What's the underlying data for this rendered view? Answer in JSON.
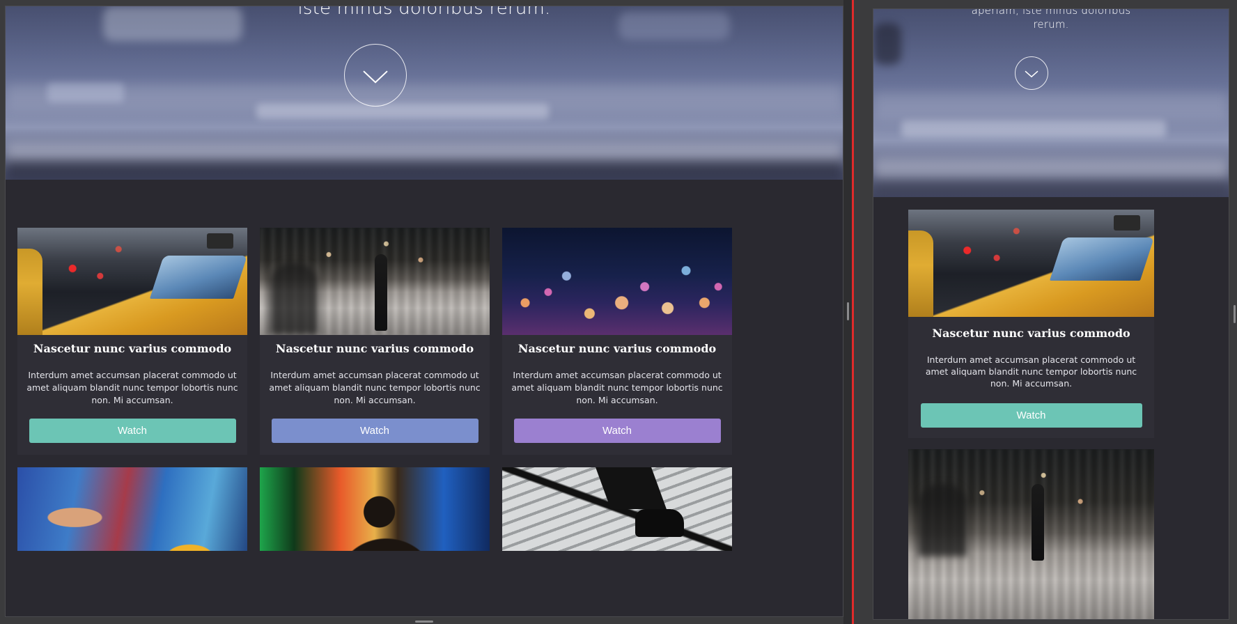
{
  "hero": {
    "left_subtitle": "iste minus doloribus rerum.",
    "right_subtitle_line1": "aperiam, iste minus doloribus",
    "right_subtitle_line2": "rerum."
  },
  "colors": {
    "teal": "#6cc5b5",
    "blue": "#7b8fcd",
    "purple": "#9b80d0",
    "divider": "#e02a2a",
    "card_bg": "#2f2e36",
    "page_bg": "#2a2930"
  },
  "cards": [
    {
      "title": "Nascetur nunc varius commodo",
      "text": "Interdum amet accumsan placerat commodo ut amet aliquam blandit nunc tempor lobortis nunc non. Mi accumsan.",
      "button": "Watch",
      "button_color": "#6cc5b5",
      "image": "taxi-street-photo"
    },
    {
      "title": "Nascetur nunc varius commodo",
      "text": "Interdum amet accumsan placerat commodo ut amet aliquam blandit nunc tempor lobortis nunc non. Mi accumsan.",
      "button": "Watch",
      "button_color": "#7b8fcd",
      "image": "blurred-pedestrian-photo"
    },
    {
      "title": "Nascetur nunc varius commodo",
      "text": "Interdum amet accumsan placerat commodo ut amet aliquam blandit nunc tempor lobortis nunc non. Mi accumsan.",
      "button": "Watch",
      "button_color": "#9b80d0",
      "image": "city-bokeh-photo"
    }
  ],
  "cards_row2": [
    {
      "image": "graffiti-wall-photo"
    },
    {
      "image": "neon-silhouette-photo"
    },
    {
      "image": "stairs-shoes-photo"
    }
  ],
  "mobile_card": {
    "title": "Nascetur nunc varius commodo",
    "text": "Interdum amet accumsan placerat commodo ut amet aliquam blandit nunc tempor lobortis nunc non. Mi accumsan.",
    "button": "Watch",
    "button_color": "#6cc5b5"
  },
  "icons": {
    "scroll_down": "chevron-down-icon"
  }
}
